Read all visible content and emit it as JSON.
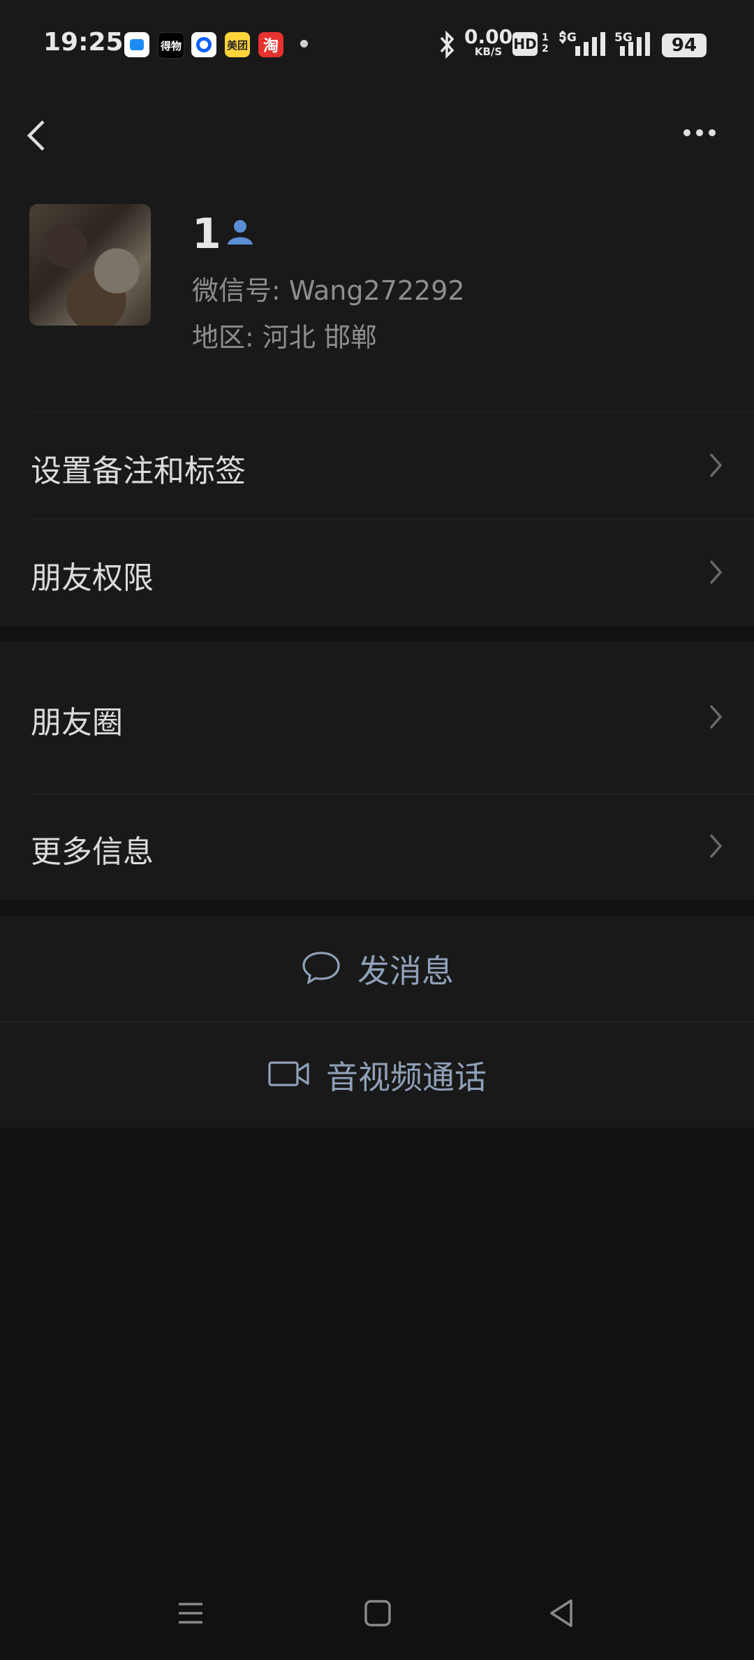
{
  "status_bar": {
    "time": "19:25",
    "apps": [
      {
        "icon": "app-blue-icon",
        "label": ""
      },
      {
        "icon": "dewu-icon",
        "label": "得物"
      },
      {
        "icon": "app-circle-icon",
        "label": ""
      },
      {
        "icon": "meituan-icon",
        "label": "美团"
      },
      {
        "icon": "taobao-icon",
        "label": "淘"
      }
    ],
    "speed_value": "0.00",
    "speed_unit": "KB/S",
    "hd_label": "HD",
    "sim_label": "12",
    "signal_1": "5G",
    "signal_2": "5G",
    "battery": "94"
  },
  "header": {
    "back_icon": "back-chevron-icon",
    "more_icon": "more-dots-icon"
  },
  "profile": {
    "name": "1",
    "gender_icon": "user-icon",
    "wechat_id": "微信号: Wang272292",
    "region": "地区: 河北 邯郸"
  },
  "menu": {
    "remark_tags": "设置备注和标签",
    "friend_permissions": "朋友权限",
    "moments": "朋友圈",
    "more_info": "更多信息"
  },
  "actions": {
    "send_message": "发消息",
    "video_call": "音视频通话"
  },
  "colors": {
    "background": "#111111",
    "panel": "#191919",
    "action_text": "#8fa0b8",
    "user_icon": "#5b8ed6"
  }
}
